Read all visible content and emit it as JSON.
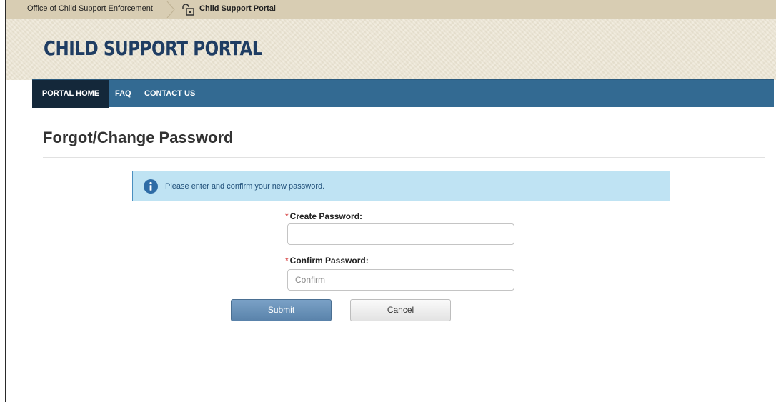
{
  "breadcrumb": {
    "first": "Office of Child Support Enforcement",
    "second": "Child Support Portal"
  },
  "header": {
    "title": "CHILD SUPPORT PORTAL"
  },
  "nav": {
    "items": [
      {
        "label": "PORTAL HOME",
        "active": true
      },
      {
        "label": "FAQ",
        "active": false
      },
      {
        "label": "CONTACT US",
        "active": false
      }
    ]
  },
  "page": {
    "title": "Forgot/Change Password"
  },
  "alert": {
    "text": "Please enter and confirm your new password.",
    "icon": "info-icon"
  },
  "form": {
    "required_mark": "*",
    "create_label": "Create Password:",
    "create_value": "",
    "create_placeholder": "",
    "confirm_label": "Confirm Password:",
    "confirm_value": "",
    "confirm_placeholder": "Confirm",
    "submit_label": "Submit",
    "cancel_label": "Cancel"
  },
  "colors": {
    "nav_bg": "#336a92",
    "nav_active_bg": "#14283a",
    "title_color": "#1f3d63",
    "alert_bg": "#bfe3f3",
    "alert_border": "#4a8fc0",
    "required": "#d12b2b"
  }
}
